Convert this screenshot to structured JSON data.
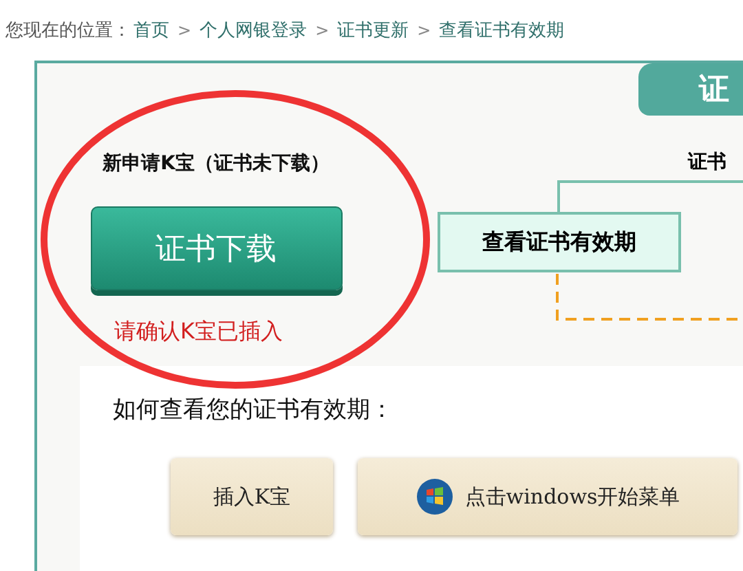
{
  "breadcrumb": {
    "label": "您现在的位置：",
    "links": [
      "首页",
      "个人网银登录",
      "证书更新",
      "查看证书有效期"
    ],
    "separator": ">"
  },
  "panel": {
    "tab": "证",
    "new_kbao": {
      "title": "新申请K宝（证书未下载）",
      "button": "证书下载",
      "hint": "请确认K宝已插入"
    },
    "flow": {
      "title": "证书",
      "node": "查看证书有效期"
    },
    "howto": {
      "title": "如何查看您的证书有效期：",
      "steps": [
        {
          "label": "插入K宝",
          "kind": "text"
        },
        {
          "label": "点击windows开始菜单",
          "kind": "windows"
        }
      ]
    }
  }
}
